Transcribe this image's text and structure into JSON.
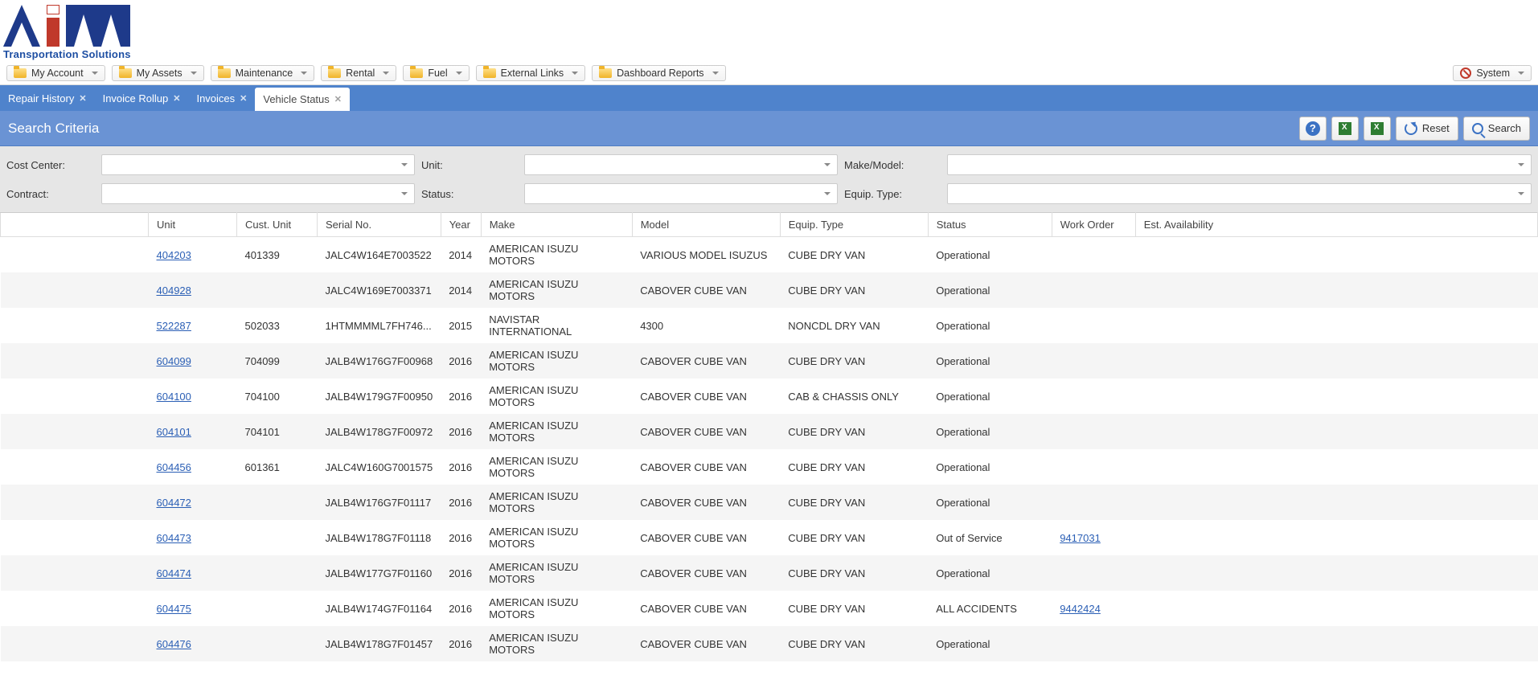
{
  "logo_subtitle": "Transportation Solutions",
  "menu": {
    "items": [
      "My Account",
      "My Assets",
      "Maintenance",
      "Rental",
      "Fuel",
      "External Links",
      "Dashboard Reports"
    ],
    "system": "System"
  },
  "tabs": [
    {
      "label": "Repair History",
      "active": false
    },
    {
      "label": "Invoice Rollup",
      "active": false
    },
    {
      "label": "Invoices",
      "active": false
    },
    {
      "label": "Vehicle Status",
      "active": true
    }
  ],
  "criteria": {
    "title": "Search Criteria",
    "reset_label": "Reset",
    "search_label": "Search"
  },
  "filters": {
    "cost_center": {
      "label": "Cost Center:",
      "value": ""
    },
    "unit": {
      "label": "Unit:",
      "value": ""
    },
    "make_model": {
      "label": "Make/Model:",
      "value": ""
    },
    "contract": {
      "label": "Contract:",
      "value": ""
    },
    "status": {
      "label": "Status:",
      "value": ""
    },
    "equip_type": {
      "label": "Equip. Type:",
      "value": ""
    }
  },
  "columns": [
    "",
    "Unit",
    "Cust. Unit",
    "Serial No.",
    "Year",
    "Make",
    "Model",
    "Equip. Type",
    "Status",
    "Work Order",
    "Est. Availability"
  ],
  "rows": [
    {
      "unit": "404203",
      "cust": "401339",
      "serial": "JALC4W164E7003522",
      "year": "2014",
      "make": "AMERICAN ISUZU MOTORS",
      "model": "VARIOUS MODEL ISUZUS",
      "equip": "CUBE DRY VAN",
      "status": "Operational",
      "wo": "",
      "est": ""
    },
    {
      "unit": "404928",
      "cust": "",
      "serial": "JALC4W169E7003371",
      "year": "2014",
      "make": "AMERICAN ISUZU MOTORS",
      "model": "CABOVER CUBE VAN",
      "equip": "CUBE DRY VAN",
      "status": "Operational",
      "wo": "",
      "est": ""
    },
    {
      "unit": "522287",
      "cust": "502033",
      "serial": "1HTMMMML7FH746...",
      "year": "2015",
      "make": "NAVISTAR INTERNATIONAL",
      "model": "4300",
      "equip": "NONCDL DRY VAN",
      "status": "Operational",
      "wo": "",
      "est": ""
    },
    {
      "unit": "604099",
      "cust": "704099",
      "serial": "JALB4W176G7F00968",
      "year": "2016",
      "make": "AMERICAN ISUZU MOTORS",
      "model": "CABOVER CUBE VAN",
      "equip": "CUBE DRY VAN",
      "status": "Operational",
      "wo": "",
      "est": ""
    },
    {
      "unit": "604100",
      "cust": "704100",
      "serial": "JALB4W179G7F00950",
      "year": "2016",
      "make": "AMERICAN ISUZU MOTORS",
      "model": "CABOVER CUBE VAN",
      "equip": "CAB & CHASSIS ONLY",
      "status": "Operational",
      "wo": "",
      "est": ""
    },
    {
      "unit": "604101",
      "cust": "704101",
      "serial": "JALB4W178G7F00972",
      "year": "2016",
      "make": "AMERICAN ISUZU MOTORS",
      "model": "CABOVER CUBE VAN",
      "equip": "CUBE DRY VAN",
      "status": "Operational",
      "wo": "",
      "est": ""
    },
    {
      "unit": "604456",
      "cust": "601361",
      "serial": "JALC4W160G7001575",
      "year": "2016",
      "make": "AMERICAN ISUZU MOTORS",
      "model": "CABOVER CUBE VAN",
      "equip": "CUBE DRY VAN",
      "status": "Operational",
      "wo": "",
      "est": ""
    },
    {
      "unit": "604472",
      "cust": "",
      "serial": "JALB4W176G7F01117",
      "year": "2016",
      "make": "AMERICAN ISUZU MOTORS",
      "model": "CABOVER CUBE VAN",
      "equip": "CUBE DRY VAN",
      "status": "Operational",
      "wo": "",
      "est": ""
    },
    {
      "unit": "604473",
      "cust": "",
      "serial": "JALB4W178G7F01118",
      "year": "2016",
      "make": "AMERICAN ISUZU MOTORS",
      "model": "CABOVER CUBE VAN",
      "equip": "CUBE DRY VAN",
      "status": "Out of Service",
      "wo": "9417031",
      "est": ""
    },
    {
      "unit": "604474",
      "cust": "",
      "serial": "JALB4W177G7F01160",
      "year": "2016",
      "make": "AMERICAN ISUZU MOTORS",
      "model": "CABOVER CUBE VAN",
      "equip": "CUBE DRY VAN",
      "status": "Operational",
      "wo": "",
      "est": ""
    },
    {
      "unit": "604475",
      "cust": "",
      "serial": "JALB4W174G7F01164",
      "year": "2016",
      "make": "AMERICAN ISUZU MOTORS",
      "model": "CABOVER CUBE VAN",
      "equip": "CUBE DRY VAN",
      "status": "ALL ACCIDENTS",
      "wo": "9442424",
      "est": ""
    },
    {
      "unit": "604476",
      "cust": "",
      "serial": "JALB4W178G7F01457",
      "year": "2016",
      "make": "AMERICAN ISUZU MOTORS",
      "model": "CABOVER CUBE VAN",
      "equip": "CUBE DRY VAN",
      "status": "Operational",
      "wo": "",
      "est": ""
    }
  ]
}
